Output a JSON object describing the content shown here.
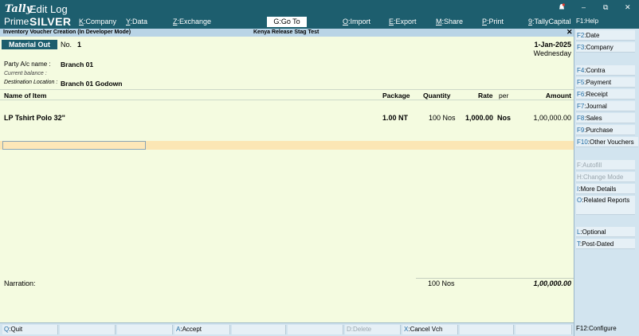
{
  "app": {
    "logo_tally": "Tally",
    "logo_prime": "Prime",
    "logo_edition": "SILVER",
    "title": "Edit Log"
  },
  "top_menu": [
    {
      "key": "K",
      "label": ":Company"
    },
    {
      "key": "Y",
      "label": ":Data"
    },
    {
      "key": "Z",
      "label": ":Exchange"
    },
    {
      "key": "G",
      "label": ":Go To"
    },
    {
      "key": "O",
      "label": ":Import"
    },
    {
      "key": "E",
      "label": ":Export"
    },
    {
      "key": "M",
      "label": ":Share"
    },
    {
      "key": "P",
      "label": ":Print"
    },
    {
      "key": "9",
      "label": ":TallyCapital"
    }
  ],
  "window_controls": {
    "min": "–",
    "restore": "⧉",
    "close": "✕"
  },
  "subbar": {
    "left": "Inventory Voucher Creation (In Developer Mode)",
    "center": "Kenya Release Stag Test",
    "close": "✕"
  },
  "voucher": {
    "type": "Material Out",
    "no_label": "No.",
    "no": "1",
    "date": "1-Jan-2025",
    "day": "Wednesday",
    "party_label": "Party A/c name",
    "party_value": "Branch 01",
    "balance_label": "Current balance",
    "destination_label": "Destination Location",
    "destination_value": "Branch 01 Godown"
  },
  "columns": {
    "name": "Name of Item",
    "package": "Package",
    "quantity": "Quantity",
    "rate": "Rate",
    "per": "per",
    "amount": "Amount"
  },
  "items": [
    {
      "name": "LP Tshirt Polo 32\"",
      "package": "1.00  NT",
      "quantity": "100 Nos",
      "rate": "1,000.00",
      "per": "Nos",
      "amount": "1,00,000.00"
    }
  ],
  "narration_label": "Narration:",
  "totals": {
    "quantity": "100 Nos",
    "amount": "1,00,000.00"
  },
  "bottom_bar": [
    {
      "key": "Q",
      "label": ":Quit",
      "enabled": true
    },
    {
      "key": "",
      "label": "",
      "enabled": true
    },
    {
      "key": "",
      "label": "",
      "enabled": true
    },
    {
      "key": "A",
      "label": ":Accept",
      "enabled": true
    },
    {
      "key": "",
      "label": "",
      "enabled": true
    },
    {
      "key": "",
      "label": "",
      "enabled": true
    },
    {
      "key": "D",
      "label": ":Delete",
      "enabled": false
    },
    {
      "key": "X",
      "label": ":Cancel Vch",
      "enabled": true
    },
    {
      "key": "",
      "label": "",
      "enabled": true
    },
    {
      "key": "",
      "label": "",
      "enabled": true
    }
  ],
  "right_panel": {
    "help": "F1:Help",
    "configure": "F12:Configure",
    "buttons": [
      {
        "key": "F2",
        "label": ":Date",
        "enabled": true
      },
      {
        "key": "F3",
        "label": ":Company",
        "enabled": true
      },
      {
        "key": "F4",
        "label": ":Contra",
        "enabled": true
      },
      {
        "key": "F5",
        "label": ":Payment",
        "enabled": true
      },
      {
        "key": "F6",
        "label": ":Receipt",
        "enabled": true
      },
      {
        "key": "F7",
        "label": ":Journal",
        "enabled": true
      },
      {
        "key": "F8",
        "label": ":Sales",
        "enabled": true
      },
      {
        "key": "F9",
        "label": ":Purchase",
        "enabled": true
      },
      {
        "key": "F10",
        "label": ":Other Vouchers",
        "enabled": true
      },
      {
        "key": "F",
        "label": ":Autofill",
        "enabled": false
      },
      {
        "key": "H",
        "label": ":Change Mode",
        "enabled": false
      },
      {
        "key": "I",
        "label": ":More Details",
        "enabled": true
      },
      {
        "key": "O",
        "label": ":Related Reports",
        "enabled": true
      },
      {
        "key": "L",
        "label": ":Optional",
        "enabled": true
      },
      {
        "key": "T",
        "label": ":Post-Dated",
        "enabled": true
      }
    ]
  }
}
